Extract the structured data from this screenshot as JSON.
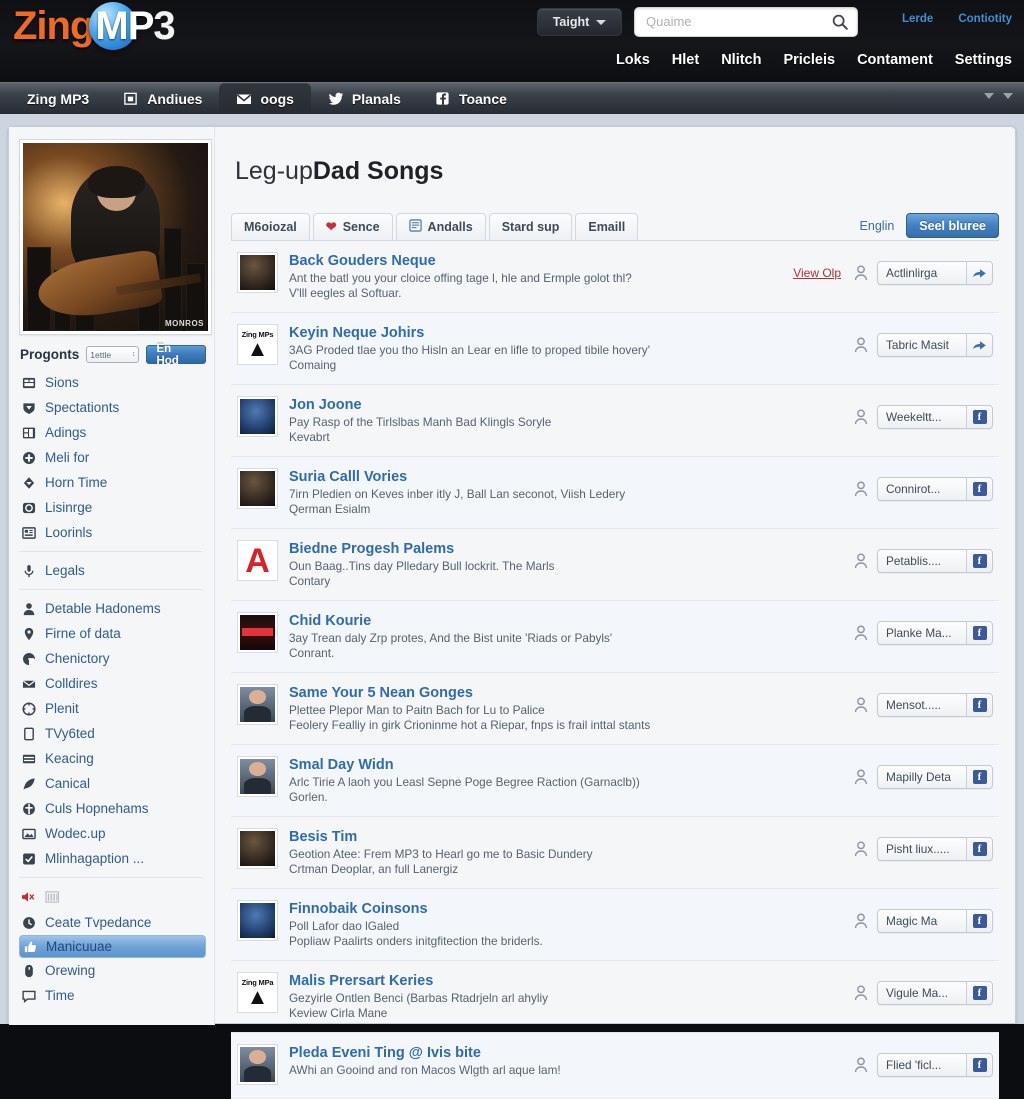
{
  "brand": {
    "part1": "Zing",
    "part2": "MP",
    "part3": "3"
  },
  "header": {
    "account_button": "Taight",
    "search_placeholder": "Quaime",
    "search_icon": "search-icon",
    "small_links": [
      "Lerde",
      "Contiotity"
    ],
    "main_links": [
      "Loks",
      "Hlet",
      "Nlitch",
      "Pricleis",
      "Contament",
      "Settings"
    ]
  },
  "tabstrip": {
    "tabs": [
      {
        "label": "Zing MP3",
        "icon": "none",
        "active": false
      },
      {
        "label": "Andiues",
        "icon": "building-icon",
        "active": false
      },
      {
        "label": "oogs",
        "icon": "envelope-icon",
        "active": true
      },
      {
        "label": "Planals",
        "icon": "twitter-bird-icon",
        "active": false
      },
      {
        "label": "Toance",
        "icon": "facebook-icon",
        "active": false
      }
    ]
  },
  "sidebar": {
    "avatar_watermark": "MONROS",
    "progonts_label": "Progonts",
    "progonts_select": "1ettle",
    "progonts_button": "En Hod",
    "group1": [
      {
        "label": "Sions",
        "icon": "grid-icon"
      },
      {
        "label": "Spectationts",
        "icon": "shield-icon"
      },
      {
        "label": "Adings",
        "icon": "layout-icon"
      },
      {
        "label": "Meli for",
        "icon": "plus-circle-icon"
      },
      {
        "label": "Horn Time",
        "icon": "diamond-icon"
      },
      {
        "label": "Lisinrge",
        "icon": "camera-icon"
      },
      {
        "label": "Loorinls",
        "icon": "window-icon"
      }
    ],
    "group2": [
      {
        "label": "Legals",
        "icon": "microphone-icon"
      }
    ],
    "group3": [
      {
        "label": "Detable Hadonems",
        "icon": "person-icon"
      },
      {
        "label": "Firne of data",
        "icon": "map-pin-icon"
      },
      {
        "label": "Chenictory",
        "icon": "globe-icon"
      },
      {
        "label": "Colldires",
        "icon": "mail-icon"
      },
      {
        "label": "Plenit",
        "icon": "compass-icon"
      },
      {
        "label": "TVy6ted",
        "icon": "document-icon"
      },
      {
        "label": "Keacing",
        "icon": "list-icon"
      },
      {
        "label": "Canical",
        "icon": "feather-icon"
      },
      {
        "label": "Culs Hopnehams",
        "icon": "anchor-icon"
      },
      {
        "label": "Wodec.up",
        "icon": "image-icon"
      },
      {
        "label": "Mlinhagaption ...",
        "icon": "check-square-icon"
      }
    ],
    "speaker_row": {
      "icon1": "speaker-mute-icon",
      "icon2": "equalizer-icon"
    },
    "group4": [
      {
        "label": "Ceate Tvpedance",
        "icon": "clock-icon",
        "selected": false
      },
      {
        "label": "Manicuuae",
        "icon": "thumb-up-icon",
        "selected": true
      },
      {
        "label": "Orewing",
        "icon": "mouse-icon",
        "selected": false
      },
      {
        "label": "Time",
        "icon": "comment-icon",
        "selected": false
      }
    ]
  },
  "main": {
    "title_light": "Leg-up",
    "title_bold": "Dad Songs",
    "toolbar": {
      "buttons": [
        {
          "label": "M6oiozal",
          "icon": "none"
        },
        {
          "label": "Sence",
          "icon": "heart-icon"
        },
        {
          "label": "Andalls",
          "icon": "note-icon"
        },
        {
          "label": "Stard sup",
          "icon": "none"
        },
        {
          "label": "Emaill",
          "icon": "none"
        }
      ],
      "right_link": "Englin",
      "right_button": "Seel bluree"
    },
    "rows": [
      {
        "title": "Back Gouders Neque",
        "desc1": "Ant the batl you your cloice offing tage l, hle and Ermple golot thl?",
        "desc2": "V'lll eegles al Softuar.",
        "view_link": "View Olp",
        "action": "Actlinlirga",
        "thumb": "t-dark",
        "action_icon": "share-icon"
      },
      {
        "title": "Keyin Neque Johirs",
        "desc1": "3AG Proded tlae you tho Hisln an Lear en lifle to proped tibile hovery'",
        "desc2": "Comaing",
        "view_link": "",
        "action": "Tabric Masit",
        "thumb": "t-logo",
        "action_icon": "share-icon"
      },
      {
        "title": "Jon Joone",
        "desc1": "Pay Rasp of the Tirlslbas Manh Bad Klingls Soryle",
        "desc2": "Kevabrt",
        "view_link": "",
        "action": "Weekeltt...",
        "thumb": "t-blue",
        "action_icon": "facebook-icon"
      },
      {
        "title": "Suria Calll Vories",
        "desc1": "7irn Pledien on Keves inber itly J, Ball Lan seconot, Viish Ledery",
        "desc2": "Qerman Esialm",
        "view_link": "",
        "action": "Connirot...",
        "thumb": "t-dark",
        "action_icon": "facebook-icon"
      },
      {
        "title": "Biedne Progesh Palems",
        "desc1": "Oun Baag..Tins day Plledary Bull lockrit. The Marls",
        "desc2": "Contary",
        "view_link": "",
        "action": "Petablis....",
        "thumb": "t-red",
        "action_icon": "facebook-icon"
      },
      {
        "title": "Chid Kourie",
        "desc1": "3ay Trean daly Zrp protes, And the Bist unite 'Riads or Pabyls'",
        "desc2": "Conrant.",
        "view_link": "",
        "action": "Planke Ma...",
        "thumb": "t-poster",
        "action_icon": "facebook-icon"
      },
      {
        "title": "Same Your 5 Nean Gonges",
        "desc1": "Plettee Plepor Man to Paitn Bach for Lu to Palice",
        "desc2": "Feolery Fealliy in girk Crioninme hot a Riepar, fnps is frail inttal stants",
        "view_link": "",
        "action": "Mensot.....",
        "thumb": "t-face",
        "action_icon": "facebook-icon"
      },
      {
        "title": "Smal Day Widn",
        "desc1": "Arlc Tirie A laoh you Leasl Sepne Poge Begree Raction (Garnaclb))",
        "desc2": "Gorlen.",
        "view_link": "",
        "action": "Mapilly Deta",
        "thumb": "t-face",
        "action_icon": "facebook-icon"
      },
      {
        "title": "Besis Tim",
        "desc1": "Geotion Atee: Frem MP3 to Hearl go me to Basic Dundery",
        "desc2": "Crtman Deoplar, an full Lanergiz",
        "view_link": "",
        "action": "Pisht liux.....",
        "thumb": "t-dark",
        "action_icon": "facebook-icon"
      },
      {
        "title": "Finnobaik Coinsons",
        "desc1": "Poll Lafor dao lGaled",
        "desc2": "Popliaw Paalirts onders initgfitection the briderls.",
        "view_link": "",
        "action": "Magic Ma",
        "thumb": "t-blue",
        "action_icon": "facebook-icon"
      },
      {
        "title": "Malis Prersart Keries",
        "desc1": "Gezyirle Ontlen Benci (Barbas Rtadrjeln arl ahyliy",
        "desc2": "Keview Cirla Mane",
        "view_link": "",
        "action": "Vigule Ma...",
        "thumb": "t-logo",
        "action_icon": "facebook-icon"
      },
      {
        "title": "Pleda Eveni Ting @ Ivis bite",
        "desc1": "AWhi an Gooind and ron Macos Wlgth arl aque lam!",
        "desc2": "",
        "view_link": "",
        "action": "Flied 'ficl...",
        "thumb": "t-face",
        "action_icon": "facebook-icon"
      }
    ]
  },
  "colors": {
    "brand_orange": "#f06a23",
    "brand_blue": "#2f6bb0",
    "accent_button": "#4180c0",
    "link_red": "#b03038",
    "facebook": "#3b5998"
  }
}
